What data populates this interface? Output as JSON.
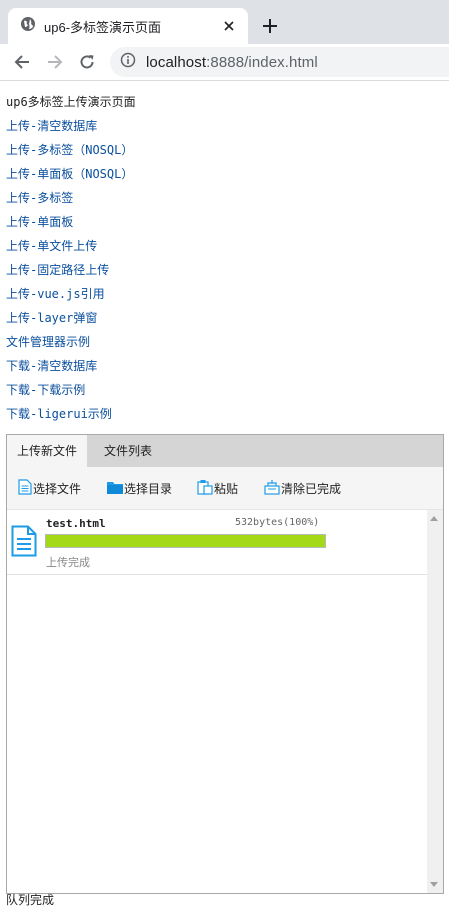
{
  "browser": {
    "tab_title": "up6-多标签演示页面",
    "url_host": "localhost",
    "url_rest": ":8888/index.html"
  },
  "page": {
    "title": "up6多标签上传演示页面",
    "links": [
      "上传-清空数据库",
      "上传-多标签（NOSQL）",
      "上传-单面板（NOSQL）",
      "上传-多标签",
      "上传-单面板",
      "上传-单文件上传",
      "上传-固定路径上传",
      "上传-vue.js引用",
      "上传-layer弹窗",
      "文件管理器示例",
      "下载-清空数据库",
      "下载-下载示例",
      "下载-ligerui示例"
    ],
    "footer": "队列完成"
  },
  "uploader": {
    "tabs": [
      "上传新文件",
      "文件列表"
    ],
    "toolbar": {
      "select_file": "选择文件",
      "select_folder": "选择目录",
      "paste": "粘贴",
      "clear_done": "清除已完成"
    },
    "files": [
      {
        "name": "test.html",
        "size": "532bytes(100%)",
        "progress": 1.0,
        "status": "上传完成"
      }
    ],
    "colors": {
      "progress": "#a3d917",
      "link": "#0a4f9d",
      "file_icon": "#1e9be6"
    }
  }
}
